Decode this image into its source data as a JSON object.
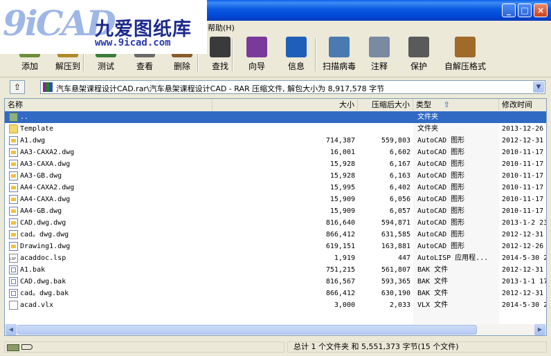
{
  "window": {
    "controls": {
      "minimize": "_",
      "maximize": "□",
      "close": "×"
    }
  },
  "logo": {
    "mark": "9iCAD",
    "chinese": "九爱图纸库",
    "url": "www.9icad.com"
  },
  "menu": {
    "help": "帮助(H)"
  },
  "toolbar": [
    {
      "label": "添加",
      "icon": "add-icon",
      "color": "#6b8e3a"
    },
    {
      "label": "解压到",
      "icon": "extract-icon",
      "color": "#b08a2a"
    },
    {
      "label": "测试",
      "icon": "test-icon",
      "color": "#3a7d3a"
    },
    {
      "label": "查看",
      "icon": "view-icon",
      "color": "#6a6a6a"
    },
    {
      "label": "删除",
      "icon": "delete-icon",
      "color": "#8a5a2a"
    },
    {
      "label": "查找",
      "icon": "find-icon",
      "color": "#3a3a3a"
    },
    {
      "label": "向导",
      "icon": "wizard-icon",
      "color": "#7a3a9a"
    },
    {
      "label": "信息",
      "icon": "info-icon",
      "color": "#1f5fb8"
    },
    {
      "label": "扫描病毒",
      "icon": "virus-scan-icon",
      "color": "#4a7ab0"
    },
    {
      "label": "注释",
      "icon": "comment-icon",
      "color": "#7a8aa0"
    },
    {
      "label": "保护",
      "icon": "protect-icon",
      "color": "#5a5a5a"
    },
    {
      "label": "自解压格式",
      "icon": "sfx-icon",
      "color": "#a06a2a"
    }
  ],
  "address": {
    "up_symbol": "⇧",
    "path": "汽车悬架课程设计CAD.rar\\汽车悬架课程设计CAD - RAR 压缩文件, 解包大小为 8,917,578 字节",
    "dropdown": "▼"
  },
  "columns": {
    "name": "名称",
    "size": "大小",
    "packed": "压缩后大小",
    "type": "类型",
    "sort_arrow": "⇧",
    "modified": "修改时间"
  },
  "files": [
    {
      "name": "..",
      "size": "",
      "packed": "",
      "type": "文件夹",
      "modified": "",
      "icon": "up",
      "selected": true
    },
    {
      "name": "Template",
      "size": "",
      "packed": "",
      "type": "文件夹",
      "modified": "2013-12-26",
      "icon": "folder"
    },
    {
      "name": "A1.dwg",
      "size": "714,387",
      "packed": "559,803",
      "type": "AutoCAD 图形",
      "modified": "2012-12-31",
      "icon": "dwg"
    },
    {
      "name": "AA3-CAXA2.dwg",
      "size": "16,001",
      "packed": "6,602",
      "type": "AutoCAD 图形",
      "modified": "2010-11-17",
      "icon": "dwg"
    },
    {
      "name": "AA3-CAXA.dwg",
      "size": "15,928",
      "packed": "6,167",
      "type": "AutoCAD 图形",
      "modified": "2010-11-17",
      "icon": "dwg"
    },
    {
      "name": "AA3-GB.dwg",
      "size": "15,928",
      "packed": "6,163",
      "type": "AutoCAD 图形",
      "modified": "2010-11-17",
      "icon": "dwg"
    },
    {
      "name": "AA4-CAXA2.dwg",
      "size": "15,995",
      "packed": "6,402",
      "type": "AutoCAD 图形",
      "modified": "2010-11-17",
      "icon": "dwg"
    },
    {
      "name": "AA4-CAXA.dwg",
      "size": "15,909",
      "packed": "6,056",
      "type": "AutoCAD 图形",
      "modified": "2010-11-17",
      "icon": "dwg"
    },
    {
      "name": "AA4-GB.dwg",
      "size": "15,909",
      "packed": "6,057",
      "type": "AutoCAD 图形",
      "modified": "2010-11-17",
      "icon": "dwg"
    },
    {
      "name": "CAD.dwg.dwg",
      "size": "816,640",
      "packed": "594,871",
      "type": "AutoCAD 图形",
      "modified": "2013-1-2 23",
      "icon": "dwg"
    },
    {
      "name": "cad。dwg.dwg",
      "size": "866,412",
      "packed": "631,585",
      "type": "AutoCAD 图形",
      "modified": "2012-12-31",
      "icon": "dwg"
    },
    {
      "name": "Drawing1.dwg",
      "size": "619,151",
      "packed": "163,881",
      "type": "AutoCAD 图形",
      "modified": "2012-12-26",
      "icon": "dwg"
    },
    {
      "name": "acaddoc.lsp",
      "size": "1,919",
      "packed": "447",
      "type": "AutoLISP 应用程...",
      "modified": "2014-5-30 2",
      "icon": "lsp"
    },
    {
      "name": "A1.bak",
      "size": "751,215",
      "packed": "561,807",
      "type": "BAK 文件",
      "modified": "2012-12-31",
      "icon": "bak"
    },
    {
      "name": "CAD.dwg.bak",
      "size": "816,567",
      "packed": "593,365",
      "type": "BAK 文件",
      "modified": "2013-1-1 17",
      "icon": "bak"
    },
    {
      "name": "cad。dwg.bak",
      "size": "866,412",
      "packed": "630,190",
      "type": "BAK 文件",
      "modified": "2012-12-31",
      "icon": "bak"
    },
    {
      "name": "acad.vlx",
      "size": "3,000",
      "packed": "2,033",
      "type": "VLX 文件",
      "modified": "2014-5-30 2",
      "icon": "vlx"
    }
  ],
  "scroll": {
    "left": "◀",
    "right": "▶"
  },
  "status": {
    "summary": "总计 1 个文件夹 和 5,551,373 字节(15 个文件)"
  }
}
